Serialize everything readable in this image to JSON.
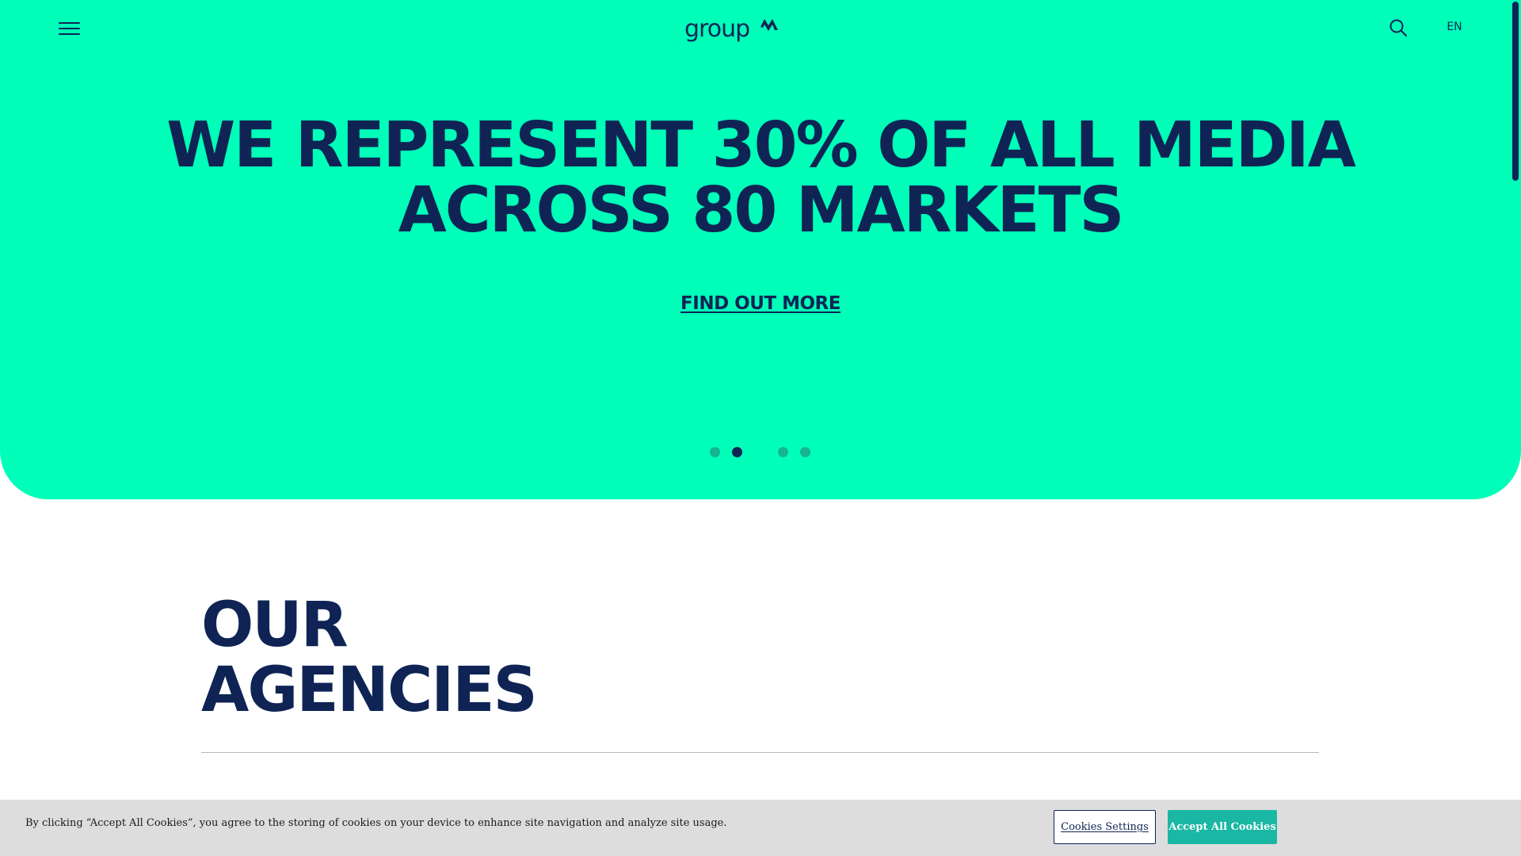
{
  "header": {
    "menu_icon": "hamburger-menu-icon",
    "logo_text": "groupM",
    "search_icon": "search-icon",
    "language": "EN"
  },
  "hero": {
    "headline_line1": "WE REPRESENT 30% OF ALL MEDIA",
    "headline_line2": "ACROSS 80 MARKETS",
    "cta_label": "FIND OUT MORE",
    "slide_count": 4,
    "active_slide": 2
  },
  "agencies": {
    "title_line1": "OUR",
    "title_line2": "AGENCIES"
  },
  "cookie_banner": {
    "message": "By clicking “Accept All Cookies”, you agree to the storing of cookies on your device to enhance site navigation and analyze site usage.",
    "settings_label": "Cookies Settings",
    "accept_label": "Accept All Cookies"
  },
  "colors": {
    "hero_background": "#00ffb9",
    "brand_navy": "#0f2455",
    "inactive_dot": "#14b58f",
    "accept_button": "#1ab7a4",
    "cookie_banner_background": "#dddddd"
  }
}
